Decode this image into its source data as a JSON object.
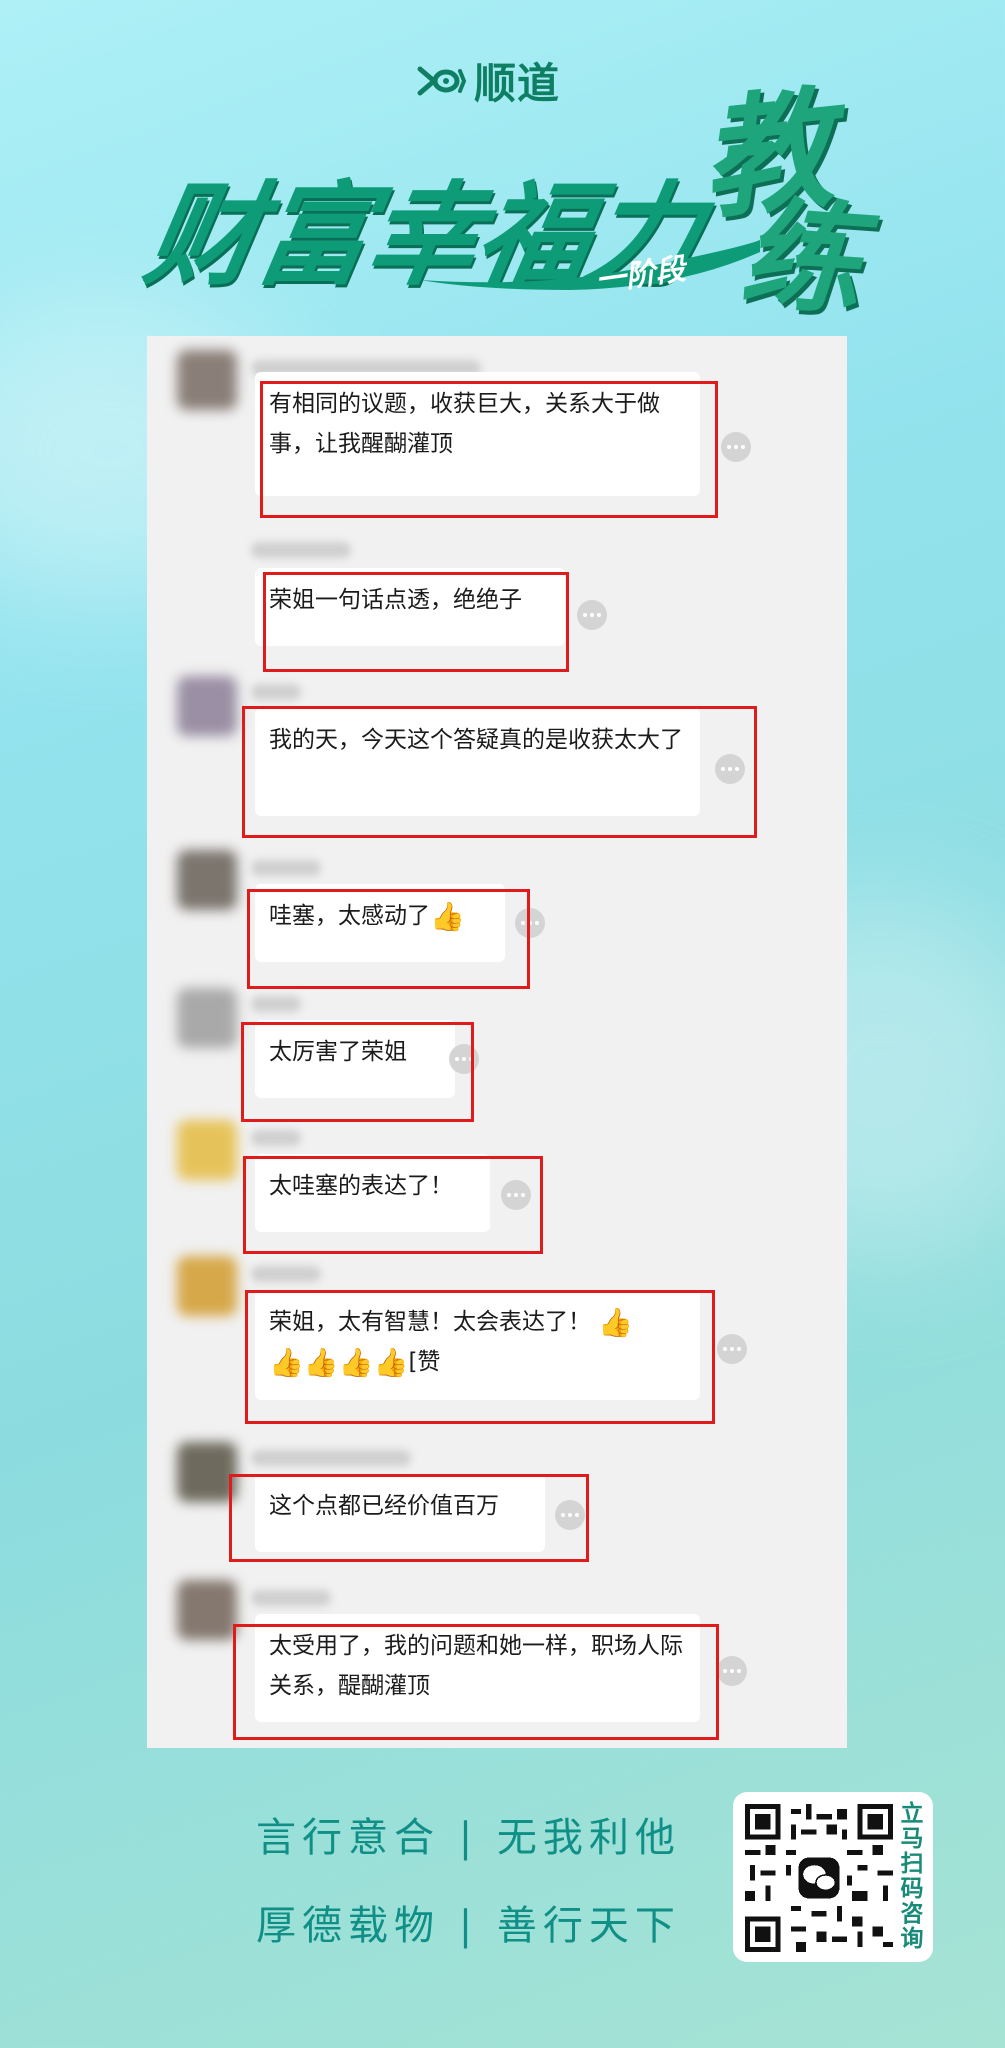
{
  "header": {
    "brand_name": "顺道",
    "title": "财富幸福力",
    "stage": "一阶段",
    "coach_1": "教",
    "coach_2": "练"
  },
  "messages": [
    {
      "text": "有相同的议题，收获巨大，关系大于做事，让我醒醐灌顶",
      "emoji": ""
    },
    {
      "text": "荣姐一句话点透，绝绝子",
      "emoji": ""
    },
    {
      "text": "我的天，今天这个答疑真的是收获太大了",
      "emoji": ""
    },
    {
      "text": "哇塞，太感动了",
      "emoji": "👍"
    },
    {
      "text": "太厉害了荣姐",
      "emoji": ""
    },
    {
      "text": "太哇塞的表达了！",
      "emoji": ""
    },
    {
      "text": "荣姐，太有智慧！太会表达了！",
      "emoji": "👍",
      "line2_emoji": "👍👍👍👍",
      "line2_text": "[赞"
    },
    {
      "text": "这个点都已经价值百万",
      "emoji": ""
    },
    {
      "text": "太受用了，我的问题和她一样，职场人际关系，醍醐灌顶",
      "emoji": ""
    }
  ],
  "footer": {
    "slogan_1": "言行意合 | 无我利他",
    "slogan_2": "厚德载物 | 善行天下",
    "qr_label": "立马扫码咨询",
    "qr_icon": "wechat-icon"
  },
  "colors": {
    "brand_green": "#0e9b78",
    "highlight_red": "#e01b1b",
    "slogan_teal": "#0f8f86"
  }
}
